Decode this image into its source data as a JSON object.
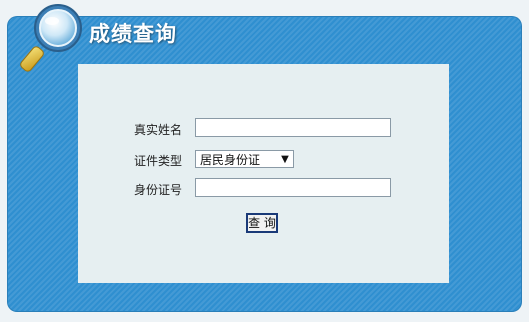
{
  "header": {
    "title": "成绩查询"
  },
  "form": {
    "name_label": "真实姓名",
    "name_value": "",
    "id_type_label": "证件类型",
    "id_type_selected": "居民身份证",
    "id_number_label": "身份证号",
    "id_number_value": "",
    "submit_label": "查 询"
  },
  "icons": {
    "magnifier": "magnifier-icon",
    "dropdown": "chevron-down-icon"
  },
  "colors": {
    "panel_blue": "#2f8fd0",
    "inner_bg": "#e6eff1",
    "button_border": "#1a3a78"
  }
}
